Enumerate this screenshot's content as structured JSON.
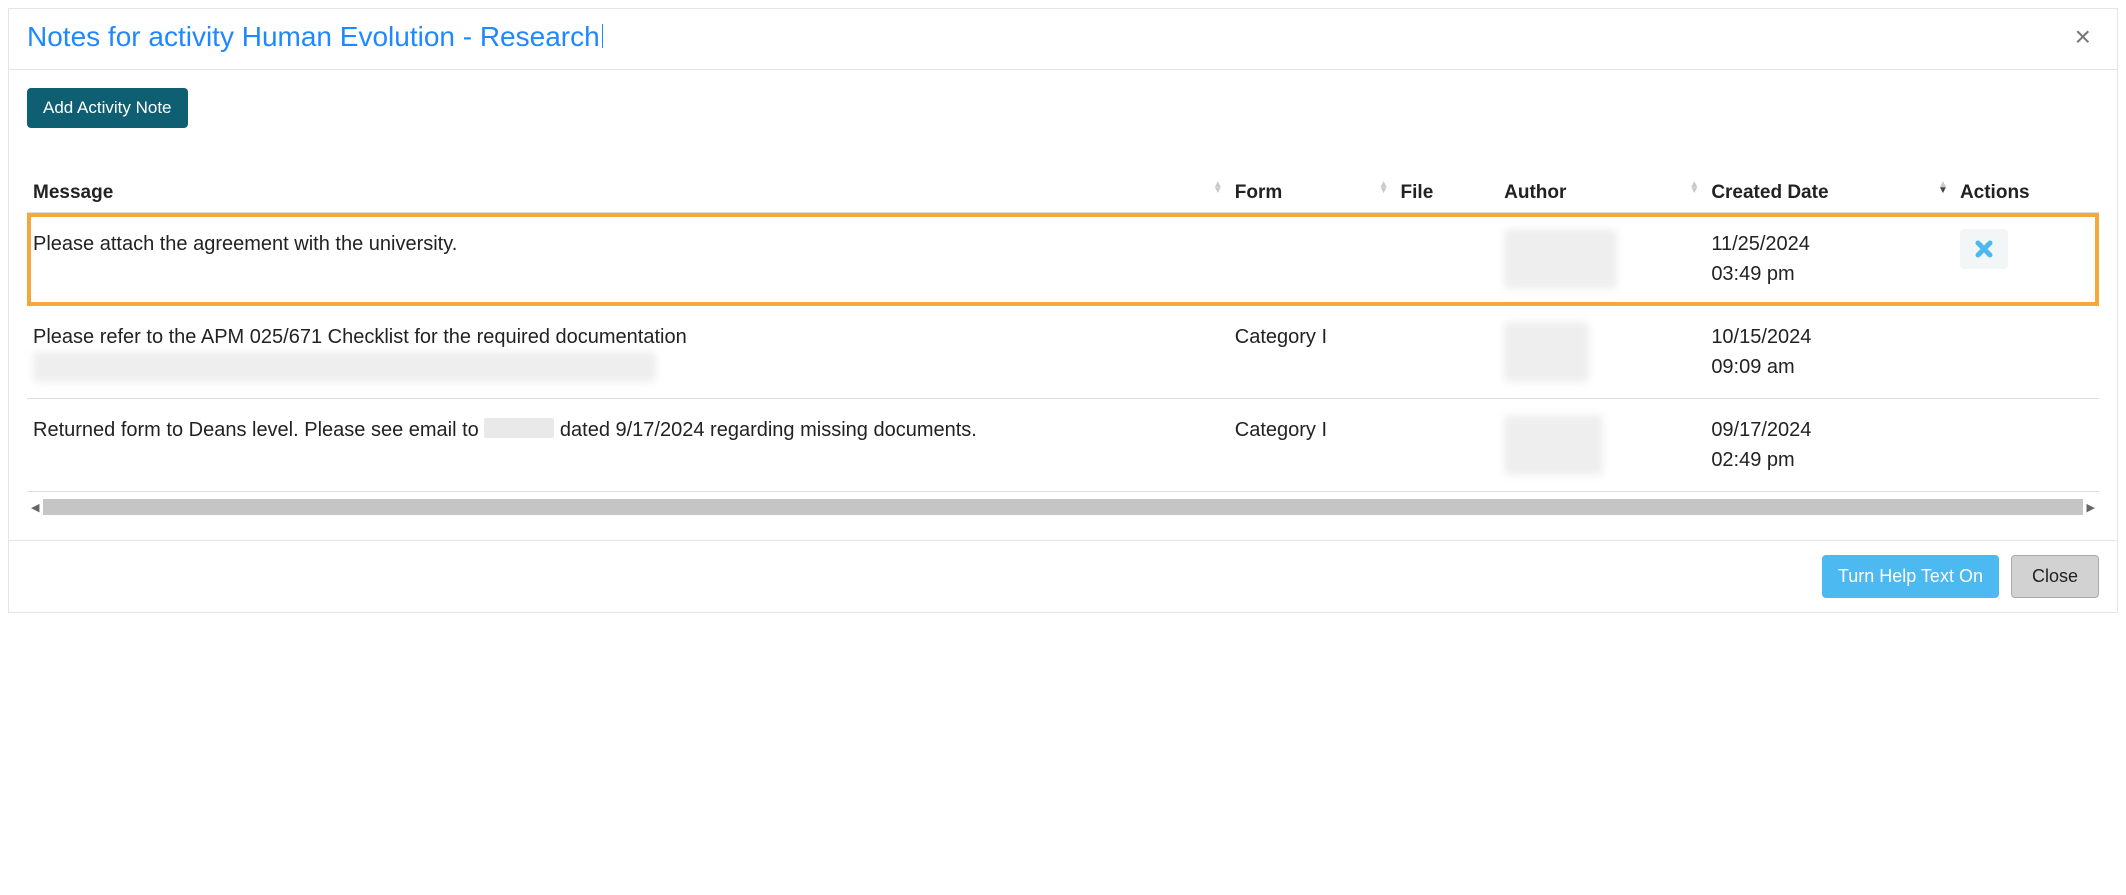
{
  "dialog": {
    "title": "Notes for activity Human Evolution - Research",
    "close_icon": "×",
    "add_button": "Add Activity Note",
    "help_button": "Turn Help Text On",
    "close_button": "Close"
  },
  "columns": {
    "message": "Message",
    "form": "Form",
    "file": "File",
    "author": "Author",
    "created": "Created Date",
    "actions": "Actions"
  },
  "rows": [
    {
      "message": "Please attach the agreement with the university.",
      "message_extra": "",
      "form": "",
      "author_redacted": true,
      "date": "11/25/2024",
      "time": "03:49 pm",
      "has_delete": true,
      "highlighted": true
    },
    {
      "message": "Please refer to the APM 025/671 Checklist for the required documentation",
      "message_extra_redacted": true,
      "form": "Category I",
      "author_redacted": true,
      "date": "10/15/2024",
      "time": "09:09 am",
      "has_delete": false,
      "highlighted": false
    },
    {
      "message_pre": "Returned form to Deans level. Please see email to ",
      "message_mid_redacted": true,
      "message_post": " dated 9/17/2024 regarding missing documents.",
      "form": "Category I",
      "author_redacted": true,
      "date": "09/17/2024",
      "time": "02:49 pm",
      "has_delete": false,
      "highlighted": false
    }
  ]
}
